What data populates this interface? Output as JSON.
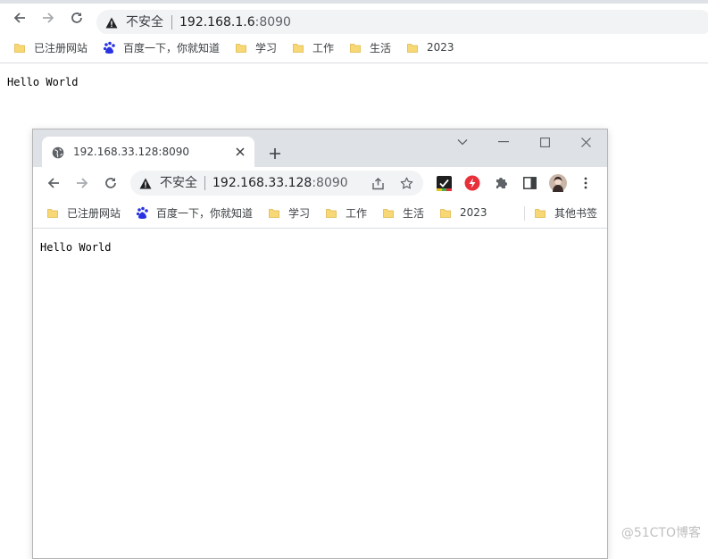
{
  "outer": {
    "address": {
      "security_label": "不安全",
      "host": "192.168.1.6",
      "port": ":8090"
    },
    "bookmarks": [
      {
        "label": "已注册网站",
        "icon": "folder-icon"
      },
      {
        "label": "百度一下，你就知道",
        "icon": "baidu-paw-icon"
      },
      {
        "label": "学习",
        "icon": "folder-icon"
      },
      {
        "label": "工作",
        "icon": "folder-icon"
      },
      {
        "label": "生活",
        "icon": "folder-icon"
      },
      {
        "label": "2023",
        "icon": "folder-icon"
      }
    ],
    "page_text": "Hello World"
  },
  "inner": {
    "tab": {
      "title": "192.168.33.128:8090"
    },
    "address": {
      "security_label": "不安全",
      "host": "192.168.33.128",
      "port": ":8090"
    },
    "bookmarks": [
      {
        "label": "已注册网站",
        "icon": "folder-icon"
      },
      {
        "label": "百度一下，你就知道",
        "icon": "baidu-paw-icon"
      },
      {
        "label": "学习",
        "icon": "folder-icon"
      },
      {
        "label": "工作",
        "icon": "folder-icon"
      },
      {
        "label": "生活",
        "icon": "folder-icon"
      },
      {
        "label": "2023",
        "icon": "folder-icon"
      }
    ],
    "other_bookmarks": "其他书签",
    "page_text": "Hello World"
  },
  "watermark": "@51CTO博客",
  "colors": {
    "folder": "#f8d775",
    "folder_edge": "#e0b84a",
    "baidu": "#2932e1",
    "extension_red": "#e8303a",
    "icon_gray": "#5f6368"
  }
}
